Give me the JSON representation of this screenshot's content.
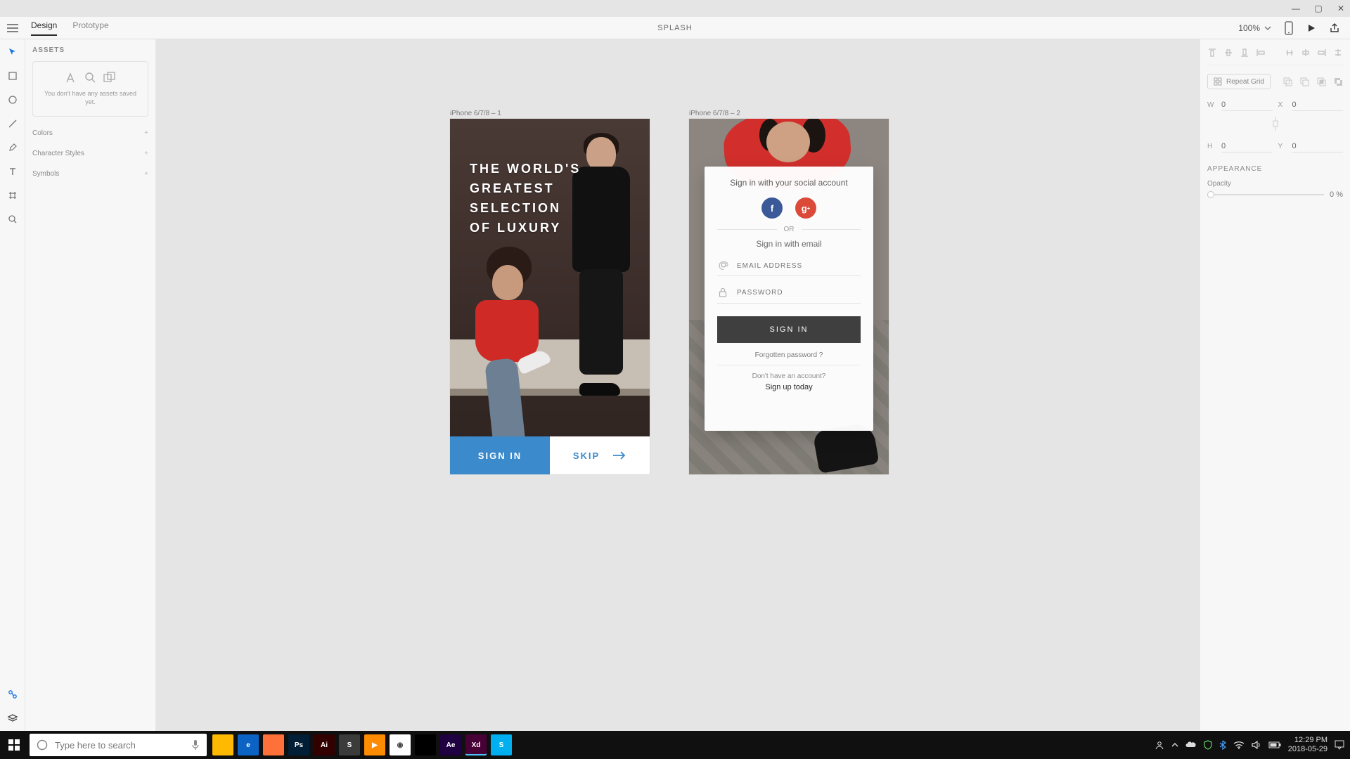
{
  "window_controls": {
    "min": "—",
    "max": "▢",
    "close": "✕"
  },
  "appbar": {
    "tabs": [
      "Design",
      "Prototype"
    ],
    "active_tab": 0,
    "document_title": "SPLASH",
    "zoom": "100%"
  },
  "assets": {
    "title": "ASSETS",
    "empty_message": "You don't have any assets saved yet.",
    "sections": [
      "Colors",
      "Character Styles",
      "Symbols"
    ]
  },
  "canvas": {
    "artboard1": {
      "label": "iPhone 6/7/8 – 1",
      "heading": "THE WORLD'S\nGREATEST\nSELECTION\nOF LUXURY",
      "signin": "SIGN IN",
      "skip": "SKIP"
    },
    "artboard2": {
      "label": "iPhone 6/7/8 – 2",
      "social_title": "Sign in with your social account",
      "or": "OR",
      "email_title": "Sign in with email",
      "email_placeholder": "EMAIL ADDRESS",
      "password_placeholder": "PASSWORD",
      "signin_btn": "SIGN IN",
      "forgot": "Forgotten password ?",
      "noacct": "Don't have an account?",
      "signup": "Sign up today"
    }
  },
  "inspector": {
    "repeat_grid": "Repeat Grid",
    "w_label": "W",
    "w": "0",
    "h_label": "H",
    "h": "0",
    "x_label": "X",
    "x": "0",
    "y_label": "Y",
    "y": "0",
    "appearance_title": "APPEARANCE",
    "opacity_label": "Opacity",
    "opacity_value": "0 %"
  },
  "taskbar": {
    "search_placeholder": "Type here to search",
    "apps": [
      {
        "name": "file-explorer",
        "bg": "#ffb900",
        "txt": ""
      },
      {
        "name": "edge",
        "bg": "#0b63c4",
        "txt": "e"
      },
      {
        "name": "firefox",
        "bg": "#ff7139",
        "txt": ""
      },
      {
        "name": "photoshop",
        "bg": "#001e36",
        "txt": "Ps"
      },
      {
        "name": "illustrator",
        "bg": "#330000",
        "txt": "Ai"
      },
      {
        "name": "sublime",
        "bg": "#3b3b3b",
        "txt": "S"
      },
      {
        "name": "media-player",
        "bg": "#ff8c00",
        "txt": "▶"
      },
      {
        "name": "chrome",
        "bg": "#ffffff",
        "txt": "◉"
      },
      {
        "name": "flag",
        "bg": "#000",
        "txt": ""
      },
      {
        "name": "after-effects",
        "bg": "#1f0040",
        "txt": "Ae"
      },
      {
        "name": "xd",
        "bg": "#470137",
        "txt": "Xd"
      },
      {
        "name": "skype",
        "bg": "#00aff0",
        "txt": "S"
      }
    ],
    "active_app_index": 10,
    "time": "12:29 PM",
    "date": "2018-05-29"
  }
}
